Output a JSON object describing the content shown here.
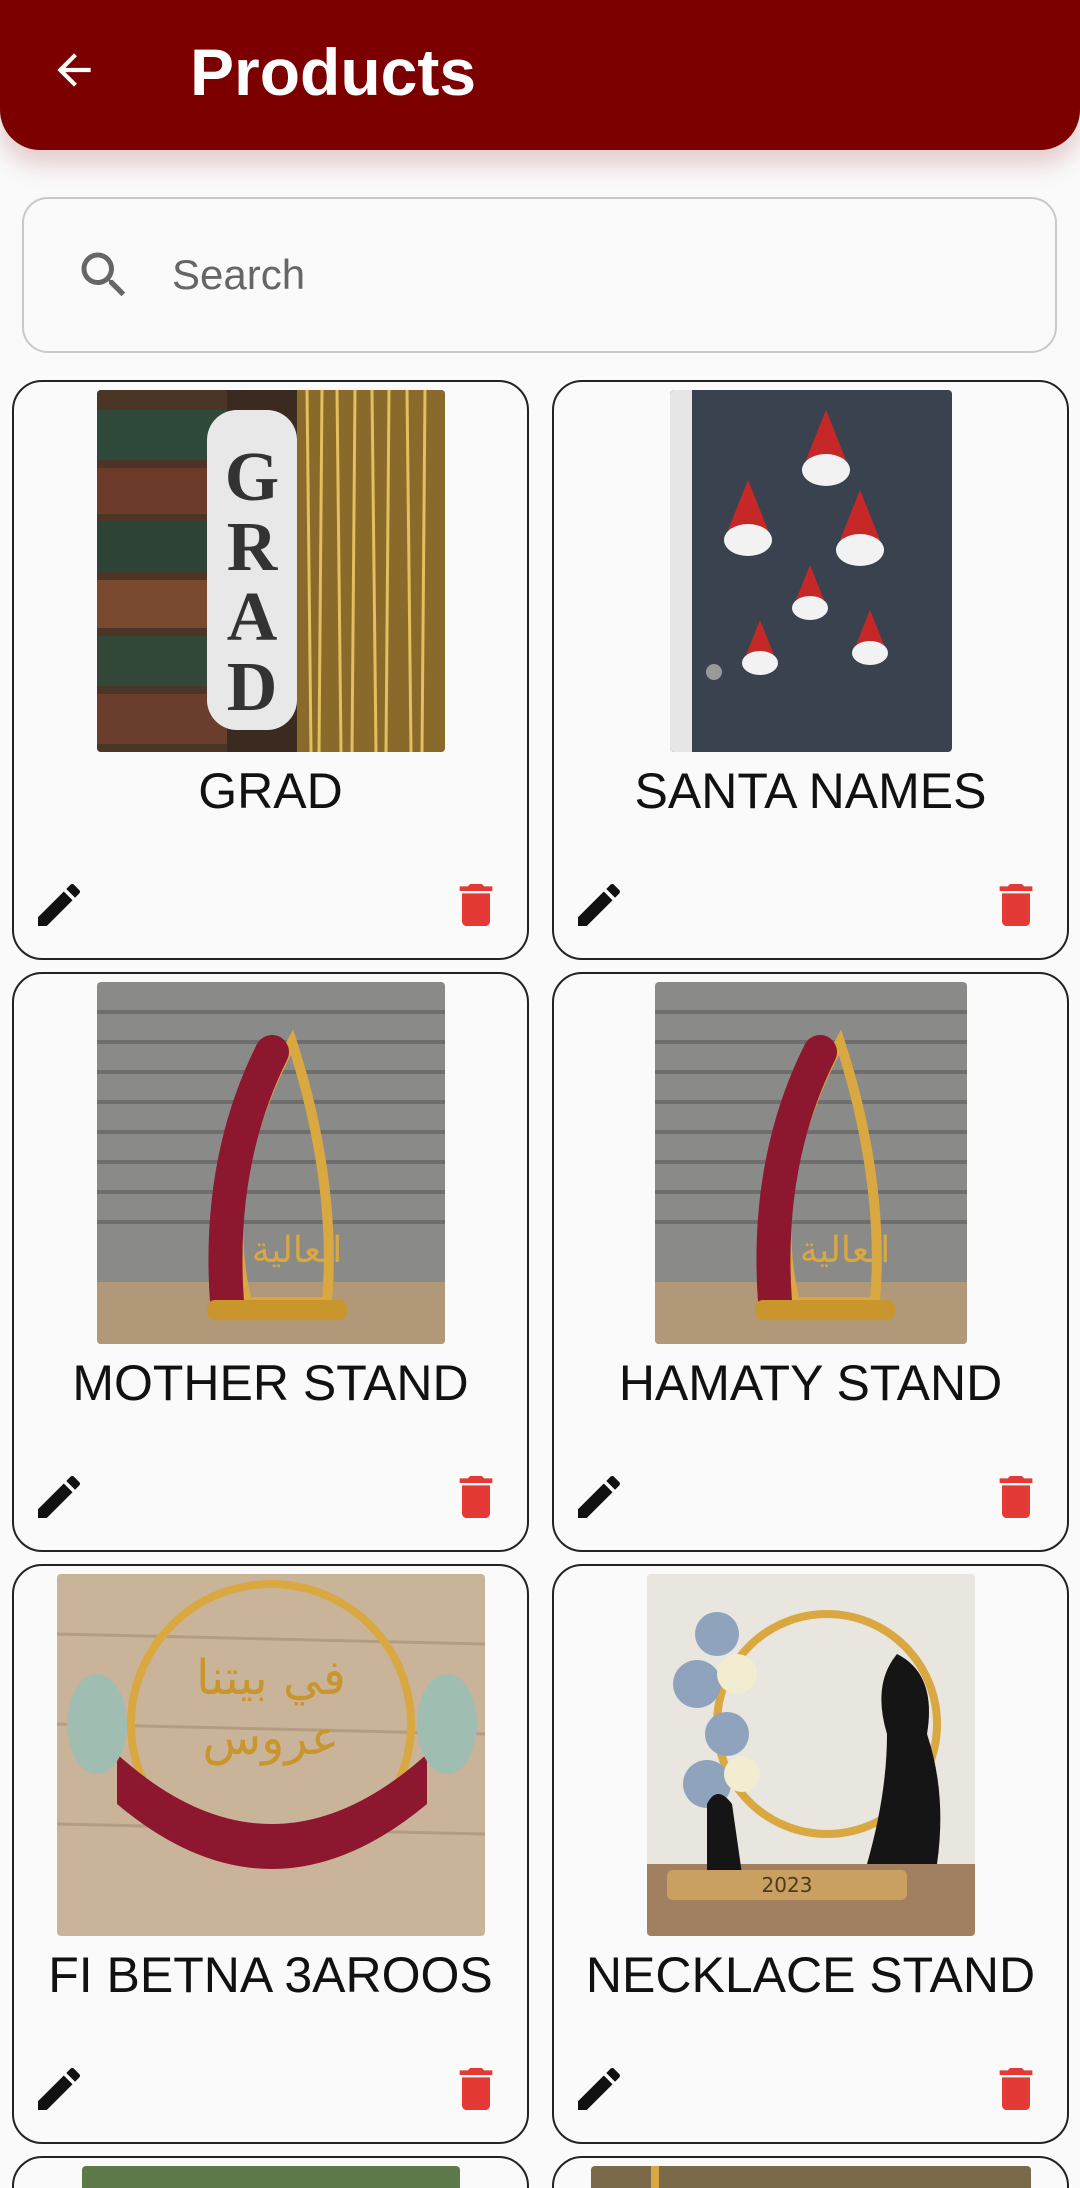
{
  "appbar": {
    "title": "Products",
    "back_icon": "arrow-left-icon",
    "bg_color": "#7d0000"
  },
  "search": {
    "placeholder": "Search",
    "icon": "search-icon"
  },
  "products": [
    {
      "name": "GRAD"
    },
    {
      "name": "SANTA NAMES"
    },
    {
      "name": "MOTHER STAND"
    },
    {
      "name": "HAMATY STAND"
    },
    {
      "name": "FI BETNA 3AROOS"
    },
    {
      "name": "NECKLACE STAND"
    }
  ],
  "icons": {
    "edit": "pencil-icon",
    "delete": "trash-icon",
    "delete_color": "#e53935"
  }
}
